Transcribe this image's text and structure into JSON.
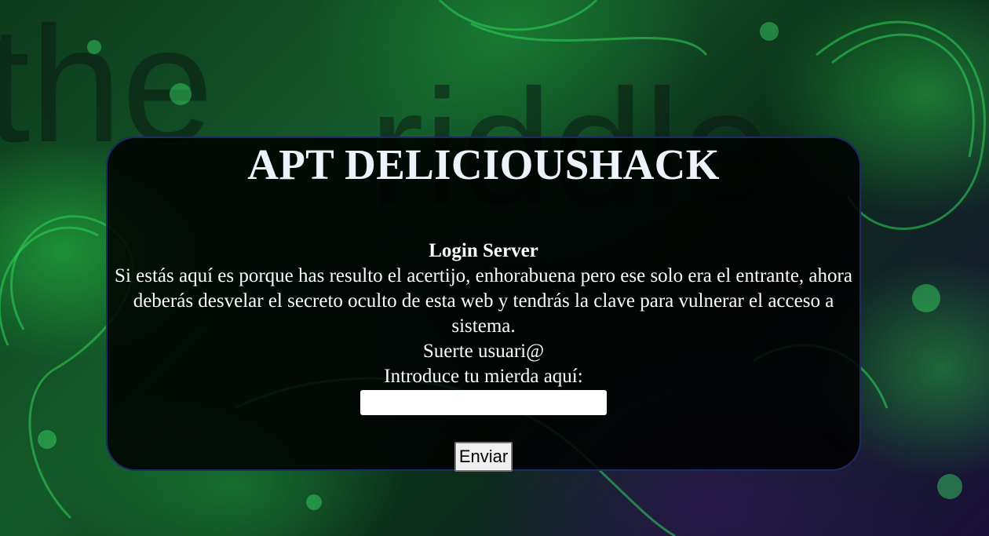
{
  "page": {
    "title": "APT DELICIOUSHACK",
    "subtitle": "Login Server",
    "description": "Si estás aquí es porque has resulto el acertijo, enhorabuena pero ese solo era el entrante, ahora deberás desvelar el secreto oculto de esta web y tendrás la clave para vulnerar el acceso a sistema.",
    "luck_text": "Suerte usuari@",
    "input_label": "Introduce tu mierda aquí:",
    "input_value": "",
    "submit_label": "Enviar"
  },
  "colors": {
    "panel_background": "#000000",
    "panel_border": "#1c2a66",
    "text": "#ffffff",
    "background_accent": "#22c24a"
  }
}
